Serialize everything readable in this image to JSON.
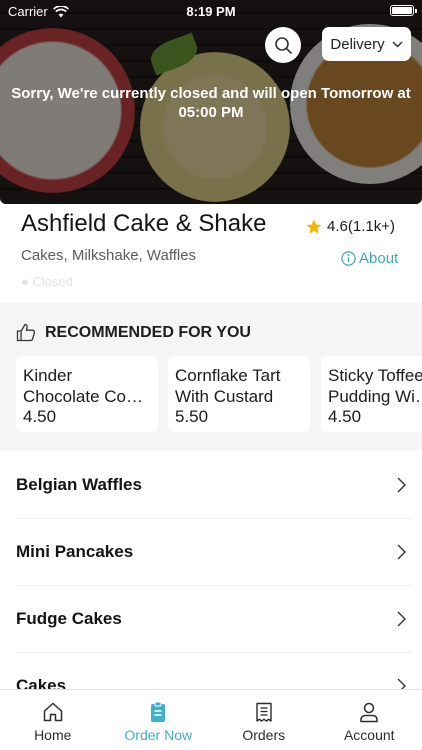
{
  "status_bar": {
    "carrier": "Carrier",
    "time": "8:19 PM"
  },
  "hero": {
    "closed_message": "Sorry, We're currently closed and will open Tomorrow at 05:00 PM"
  },
  "header": {
    "search_icon": "search-icon",
    "delivery_label": "Delivery",
    "delivery_icon": "chevron-down-icon"
  },
  "restaurant": {
    "name": "Ashfield Cake & Shake",
    "rating": "4.6(1.1k+)",
    "cuisines": "Cakes, Milkshake, Waffles",
    "about_label": "About",
    "status": "Closed"
  },
  "recommended": {
    "title": "RECOMMENDED FOR YOU",
    "items": [
      {
        "name": "Kinder\nChocolate Co…",
        "price": "4.50"
      },
      {
        "name": "Cornflake Tart\nWith Custard",
        "price": "5.50"
      },
      {
        "name": "Sticky Toffee\nPudding Wi…",
        "price": "4.50"
      }
    ]
  },
  "categories": [
    {
      "label": "Belgian Waffles"
    },
    {
      "label": "Mini Pancakes"
    },
    {
      "label": "Fudge Cakes"
    },
    {
      "label": "Cakes"
    }
  ],
  "tabs": [
    {
      "label": "Home",
      "icon": "home-icon"
    },
    {
      "label": "Order Now",
      "icon": "order-icon"
    },
    {
      "label": "Orders",
      "icon": "receipt-icon"
    },
    {
      "label": "Account",
      "icon": "account-icon"
    }
  ],
  "colors": {
    "accent": "#3fb1c8",
    "link": "#3fa7c4",
    "star": "#f5b400"
  }
}
